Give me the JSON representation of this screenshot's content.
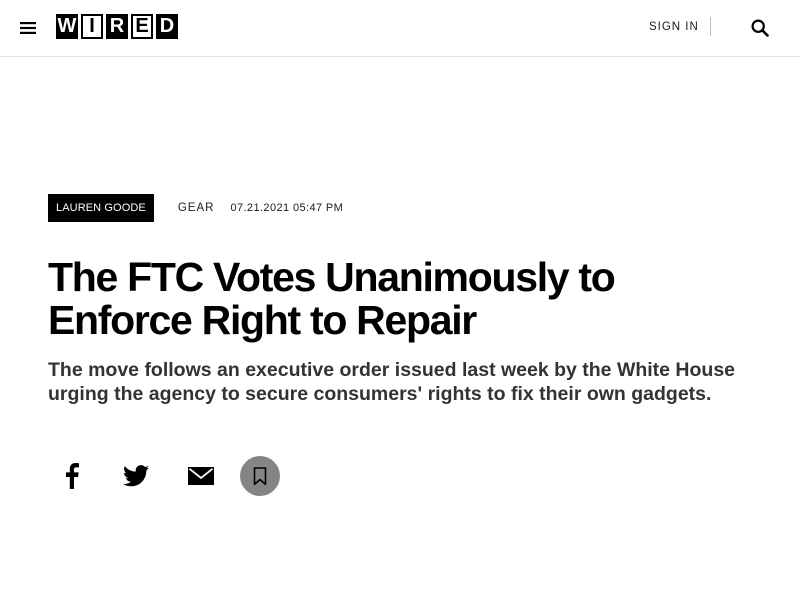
{
  "header": {
    "logo": [
      "W",
      "I",
      "R",
      "E",
      "D"
    ],
    "sign_in_label": "SIGN IN",
    "menu_icon": "hamburger-menu-icon",
    "search_icon": "search-icon"
  },
  "article": {
    "author": "LAUREN GOODE",
    "section": "GEAR",
    "timestamp": "07.21.2021 05:47 PM",
    "title": "The FTC Votes Unanimously to Enforce Right to Repair",
    "dek": "The move follows an executive order issued last week by the White House urging the agency to secure consumers' rights to fix their own gadgets."
  },
  "share": {
    "facebook_icon": "facebook-icon",
    "twitter_icon": "twitter-icon",
    "email_icon": "email-icon",
    "save_icon": "bookmark-icon",
    "save_button_color": "#858585"
  },
  "colors": {
    "text": "#000000",
    "dek": "#333333",
    "byline_bg": "#000000",
    "header_border": "#e2e2e2"
  }
}
